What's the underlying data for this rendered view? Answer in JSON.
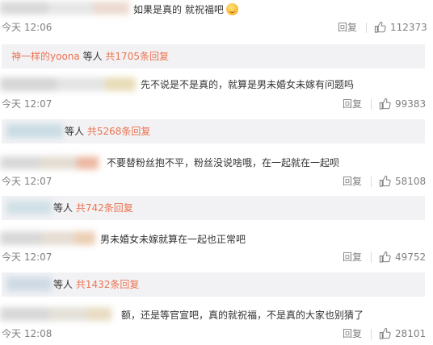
{
  "comments": [
    {
      "text": "如果是真的 就祝福吧",
      "time": "今天 12:06",
      "reply_label": "回复",
      "likes": "112373",
      "sub": {
        "user": "神一样的yoona",
        "mid": "等人",
        "count": "共1705条回复"
      }
    },
    {
      "text": "先不说是不是真的，就算是男未婚女未嫁有问题吗",
      "time": "今天 12:07",
      "reply_label": "回复",
      "likes": "99383",
      "sub": {
        "user": "",
        "mid": "等人",
        "count": "共5268条回复"
      }
    },
    {
      "text": "不要替粉丝抱不平，粉丝没说啥哦，在一起就在一起呗",
      "time": "今天 12:07",
      "reply_label": "回复",
      "likes": "58108",
      "sub": {
        "user": "",
        "mid": "等人",
        "count": "共742条回复"
      }
    },
    {
      "text": "男未婚女未嫁就算在一起也正常吧",
      "time": "今天 12:07",
      "reply_label": "回复",
      "likes": "49752",
      "sub": {
        "user": "",
        "mid": "等人",
        "count": "共1432条回复"
      }
    },
    {
      "text": "额，还是等官宣吧，真的就祝福，不是真的大家也别猜了",
      "time": "今天 12:08",
      "reply_label": "回复",
      "likes": "28101"
    }
  ],
  "icons": {
    "like": "thumbs-up-icon",
    "emoji": "smiling-face-emoji-icon"
  },
  "colors": {
    "link": "#eb7350",
    "muted": "#808080",
    "sub_bg": "#f2f2f5"
  }
}
